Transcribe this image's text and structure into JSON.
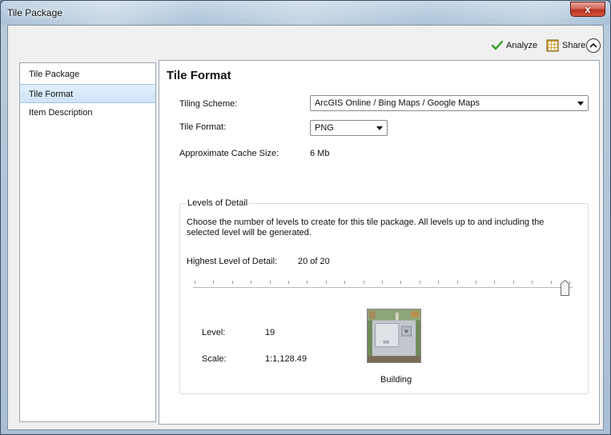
{
  "window": {
    "title": "Tile Package",
    "close_label": "x"
  },
  "toolbar": {
    "analyze_label": "Analyze",
    "share_label": "Share"
  },
  "sidebar": {
    "items": [
      {
        "label": "Tile Package"
      },
      {
        "label": "Tile Format"
      },
      {
        "label": "Item Description"
      }
    ],
    "active": "Tile Format"
  },
  "main": {
    "title": "Tile Format",
    "tiling_scheme": {
      "label": "Tiling Scheme:",
      "value": "ArcGIS Online / Bing Maps / Google Maps"
    },
    "tile_format": {
      "label": "Tile Format:",
      "value": "PNG"
    },
    "cache_size": {
      "label": "Approximate Cache Size:",
      "value": "6 Mb"
    },
    "levels": {
      "legend": "Levels of Detail",
      "description": "Choose the number of levels to create for this tile package.   All levels up to and including the selected level will be generated.",
      "highest_label": "Highest Level of Detail:",
      "highest_value": "20 of 20",
      "slider_fraction": 1.0,
      "tick_count": 21,
      "level_label": "Level:",
      "level_value": "19",
      "scale_label": "Scale:",
      "scale_value": "1:1,128.49",
      "preview_caption": "Building"
    }
  },
  "colors": {
    "selected_bg": "#cde4f7",
    "check_green": "#3a9a2a",
    "close_red": "#c8412b"
  },
  "icons": {
    "analyze": "checkmark-icon",
    "share": "share-grid-icon",
    "collapse": "chevron-up-circle-icon"
  }
}
